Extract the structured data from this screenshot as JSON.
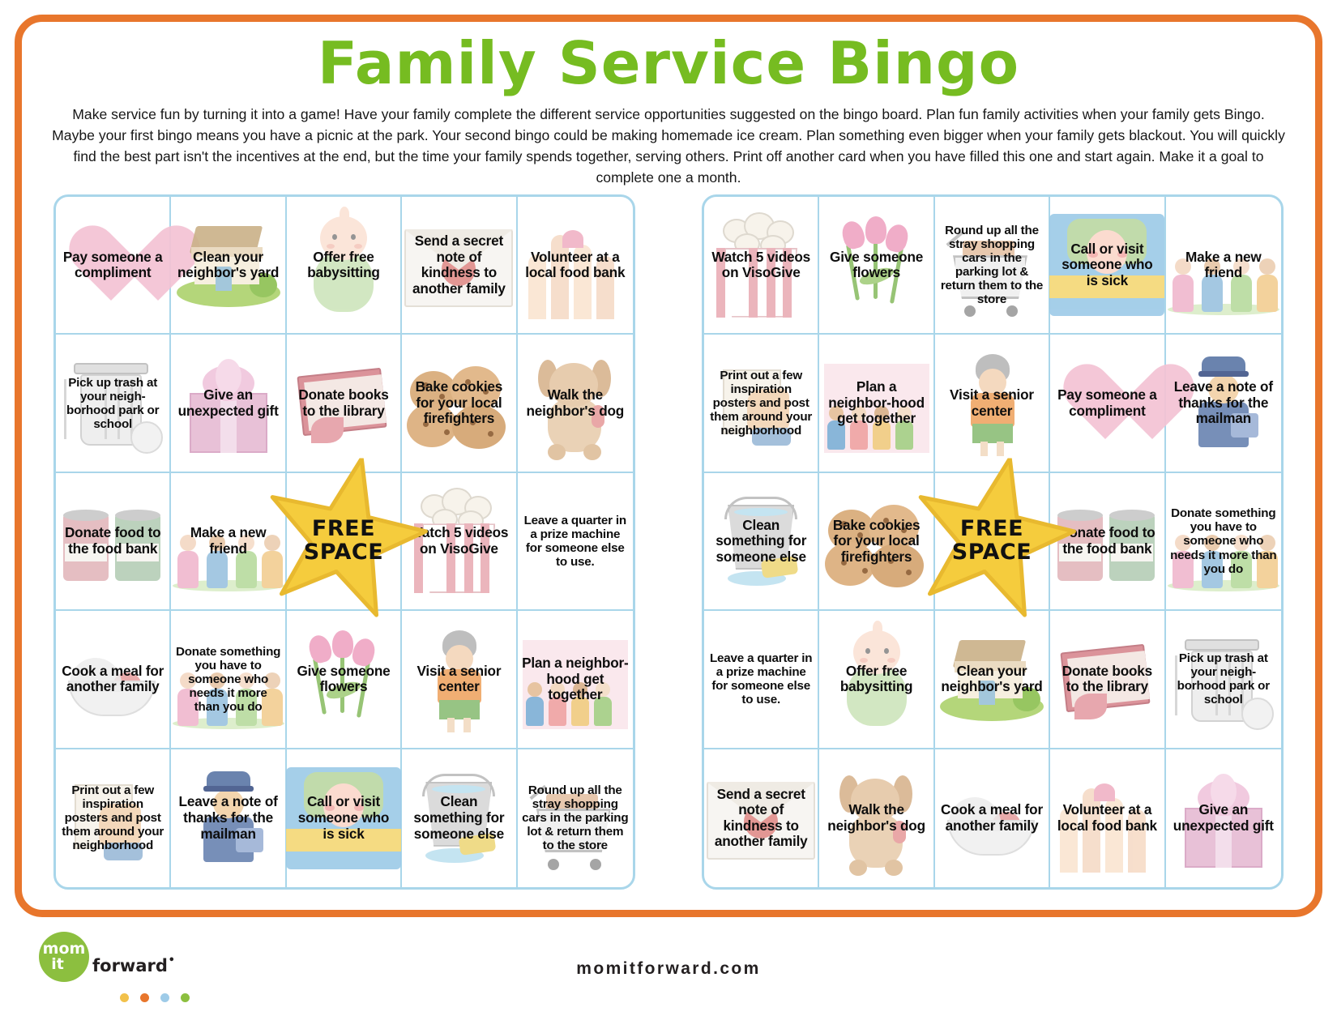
{
  "page": {
    "title": "Family Service Bingo",
    "intro": "Make service fun by turning it into a game! Have your family complete the different service opportunities suggested on the bingo board. Plan fun family activities when your family gets Bingo. Maybe your first bingo means you have a picnic at the park. Your second bingo could be making homemade ice cream. Plan something even bigger when your family gets blackout. You will quickly find the best part isn't the incentives at the end, but the time your family spends together, serving others. Print off another card when you have filled this one and start again. Make it a goal to complete one a month.",
    "free_space_label": "FREE\nSPACE"
  },
  "colors": {
    "frame_orange": "#e8762c",
    "title_green": "#76bc21",
    "grid_blue": "#a9d6ea",
    "star_yellow": "#f5cc3d",
    "star_edge": "#e8b92f",
    "logo_green": "#8cbf3f",
    "dot_yellow": "#f2c14b",
    "dot_orange": "#e8762c",
    "dot_blue": "#9ecbe8",
    "dot_green": "#8cbf3f"
  },
  "footer": {
    "logo_line1": "mom",
    "logo_line2": "it",
    "logo_word": "forward",
    "logo_trademark": "•",
    "url": "momitforward.com"
  },
  "cards": [
    {
      "name": "left-bingo-card",
      "cells": [
        {
          "text": "Pay someone a compliment",
          "art": "heart"
        },
        {
          "text": "Clean your neighbor's yard",
          "art": "house"
        },
        {
          "text": "Offer free babysitting",
          "art": "baby"
        },
        {
          "text": "Send a secret note of kindness to another family",
          "art": "env"
        },
        {
          "text": "Volunteer at a local food bank",
          "art": "hands"
        },
        {
          "text": "Pick up trash at your neigh-borhood park or school",
          "art": "trash",
          "small": true
        },
        {
          "text": "Give an unexpected gift",
          "art": "gift"
        },
        {
          "text": "Donate books to the library",
          "art": "book"
        },
        {
          "text": "Bake cookies for your local firefighters",
          "art": "cookies"
        },
        {
          "text": "Walk the neighbor's dog",
          "art": "dog"
        },
        {
          "text": "Donate food to the food bank",
          "art": "cans"
        },
        {
          "text": "Make a new friend",
          "art": "kids"
        },
        {
          "text": "FREE SPACE",
          "art": "none",
          "free": true
        },
        {
          "text": "Watch 5 videos on VisoGive",
          "art": "popcorn"
        },
        {
          "text": "Leave a quarter in a prize machine for someone else to use.",
          "art": "none",
          "small": true
        },
        {
          "text": "Cook a meal for another family",
          "art": "meal"
        },
        {
          "text": "Donate something you have to someone who needs it more than you do",
          "art": "kids",
          "small": true
        },
        {
          "text": "Give someone flowers",
          "art": "flowers"
        },
        {
          "text": "Visit a senior center",
          "art": "senior"
        },
        {
          "text": "Plan a neighbor-hood get together",
          "art": "group"
        },
        {
          "text": "Print out a few inspiration posters and post them around your neighborhood",
          "art": "poster",
          "small": true
        },
        {
          "text": "Leave a note of thanks for the mailman",
          "art": "mail"
        },
        {
          "text": "Call or visit someone who is sick",
          "art": "sick"
        },
        {
          "text": "Clean something for someone else",
          "art": "bucket"
        },
        {
          "text": "Round up all the stray shopping cars in the parking lot & return them to the store",
          "art": "cart",
          "small": true
        }
      ]
    },
    {
      "name": "right-bingo-card",
      "cells": [
        {
          "text": "Watch 5 videos on VisoGive",
          "art": "popcorn"
        },
        {
          "text": "Give someone flowers",
          "art": "flowers"
        },
        {
          "text": "Round up all the stray shopping cars in the parking lot & return them to the store",
          "art": "cart",
          "small": true
        },
        {
          "text": "Call or visit someone who is sick",
          "art": "sick"
        },
        {
          "text": "Make a new friend",
          "art": "kids"
        },
        {
          "text": "Print out a few inspiration posters and post them around your neighborhood",
          "art": "poster",
          "small": true
        },
        {
          "text": "Plan a neighbor-hood get together",
          "art": "group"
        },
        {
          "text": "Visit a senior center",
          "art": "senior"
        },
        {
          "text": "Pay someone a compliment",
          "art": "heart"
        },
        {
          "text": "Leave a note of thanks for the mailman",
          "art": "mail"
        },
        {
          "text": "Clean something for someone else",
          "art": "bucket"
        },
        {
          "text": "Bake cookies for your local firefighters",
          "art": "cookies"
        },
        {
          "text": "FREE SPACE",
          "art": "none",
          "free": true
        },
        {
          "text": "Donate food to the food bank",
          "art": "cans"
        },
        {
          "text": "Donate something you have to someone who needs it more than you do",
          "art": "kids",
          "small": true
        },
        {
          "text": "Leave a quarter in a prize machine for someone else to use.",
          "art": "none",
          "small": true
        },
        {
          "text": "Offer free babysitting",
          "art": "baby"
        },
        {
          "text": "Clean your neighbor's yard",
          "art": "house"
        },
        {
          "text": "Donate books to the library",
          "art": "book"
        },
        {
          "text": "Pick up trash at your neigh-borhood park or school",
          "art": "trash",
          "small": true
        },
        {
          "text": "Send a secret note of kindness to another family",
          "art": "env"
        },
        {
          "text": "Walk the neighbor's dog",
          "art": "dog"
        },
        {
          "text": "Cook a meal for another family",
          "art": "meal"
        },
        {
          "text": "Volunteer at a local food bank",
          "art": "hands"
        },
        {
          "text": "Give an unexpected gift",
          "art": "gift"
        }
      ]
    }
  ]
}
